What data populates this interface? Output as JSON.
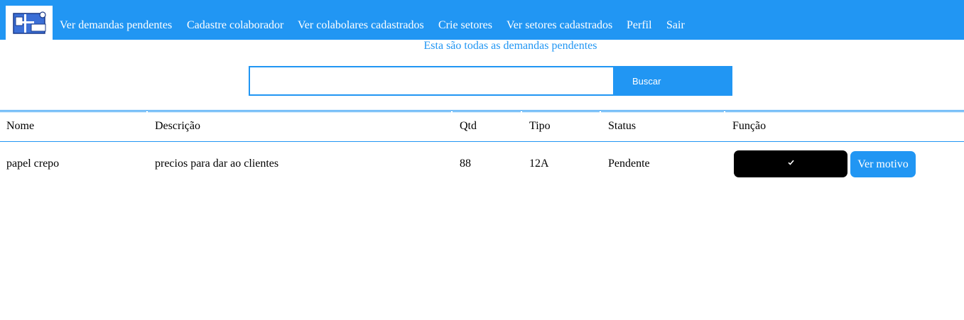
{
  "nav": {
    "items": [
      {
        "label": "Ver demandas pendentes"
      },
      {
        "label": "Cadastre colaborador"
      },
      {
        "label": "Ver colabolares cadastrados"
      },
      {
        "label": "Crie setores"
      },
      {
        "label": "Ver setores cadastrados"
      },
      {
        "label": "Perfil"
      },
      {
        "label": "Sair"
      }
    ],
    "logo_icon": "app-logo-icon",
    "background": "#2196f3"
  },
  "page": {
    "subtitle": "Esta são todas as demandas pendentes"
  },
  "search": {
    "value": "",
    "placeholder": "",
    "button_label": "Buscar"
  },
  "table": {
    "headers": [
      "Nome",
      "Descrição",
      "Qtd",
      "Tipo",
      "Status",
      "Função"
    ],
    "rows": [
      {
        "nome": "papel crepo",
        "descricao": "precios para dar ao clientes",
        "qtd": "88",
        "tipo": "12A",
        "status": "Pendente",
        "actions": {
          "approve_icon": "check-icon",
          "motivo_label": "Ver motivo"
        }
      }
    ]
  },
  "colors": {
    "accent": "#2196f3",
    "approve_button": "#000000"
  }
}
